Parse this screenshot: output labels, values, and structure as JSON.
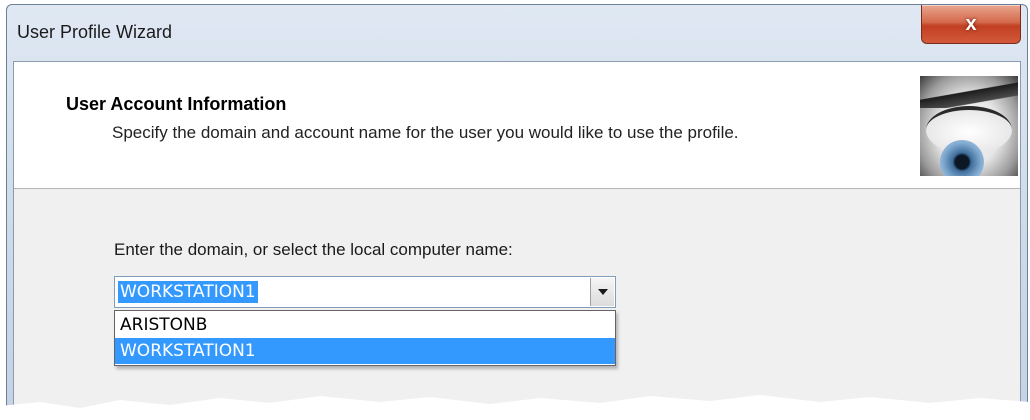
{
  "window": {
    "title": "User Profile Wizard",
    "close_glyph": "x"
  },
  "header": {
    "title": "User Account Information",
    "description": "Specify the domain and account name for the user you would like to use the profile.",
    "image_icon": "eye-icon"
  },
  "form": {
    "prompt": "Enter the domain, or select the local computer name:",
    "domain_combo": {
      "selected_value": "WORKSTATION1",
      "options": [
        "ARISTONB",
        "WORKSTATION1"
      ],
      "highlighted_option": "WORKSTATION1"
    }
  },
  "colors": {
    "selection": "#3399ff",
    "close_button": "#c13f22",
    "client_background": "#f0f0f0"
  }
}
